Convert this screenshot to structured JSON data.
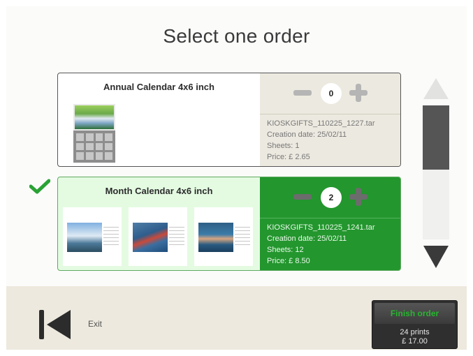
{
  "header": {
    "title": "Select one order"
  },
  "orders": [
    {
      "name": "Annual Calendar 4x6 inch",
      "quantity": "0",
      "filename": "KIOSKGIFTS_110225_1227.tar",
      "creation": "Creation date: 25/02/11",
      "sheets": "Sheets: 1",
      "price": "Price: £ 2.65",
      "selected": false
    },
    {
      "name": "Month Calendar 4x6 inch",
      "quantity": "2",
      "filename": "KIOSKGIFTS_110225_1241.tar",
      "creation": "Creation date: 25/02/11",
      "sheets": "Sheets: 12",
      "price": "Price: £ 8.50",
      "selected": true
    }
  ],
  "icons": {
    "minus": "minus-icon",
    "plus": "plus-icon",
    "check": "checkmark-icon",
    "up": "arrow-up-icon",
    "down": "arrow-down-icon",
    "back": "back-icon"
  },
  "colors": {
    "selected_panel": "#23962e",
    "selected_card": "#e4fbe2",
    "finish_text": "#27b52f",
    "footer": "#ede9de"
  },
  "footer": {
    "exit_label": "Exit",
    "finish": {
      "label": "Finish order",
      "prints": "24 prints",
      "total": "£ 17.00"
    }
  }
}
